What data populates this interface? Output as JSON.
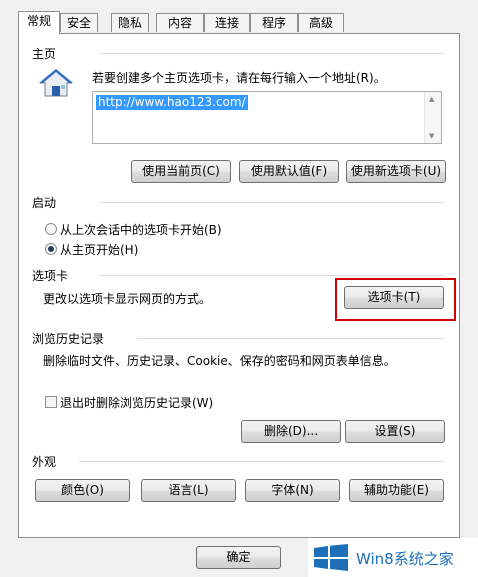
{
  "tabs": [
    {
      "label": "常规",
      "active": true
    },
    {
      "label": "安全",
      "active": false
    },
    {
      "label": "隐私",
      "active": false
    },
    {
      "label": "内容",
      "active": false
    },
    {
      "label": "连接",
      "active": false
    },
    {
      "label": "程序",
      "active": false
    },
    {
      "label": "高级",
      "active": false
    }
  ],
  "homepage": {
    "group_title": "主页",
    "description": "若要创建多个主页选项卡，请在每行输入一个地址(R)。",
    "url_value": "http://www.hao123.com/",
    "buttons": {
      "use_current": "使用当前页(C)",
      "use_default": "使用默认值(F)",
      "use_new_tab": "使用新选项卡(U)"
    }
  },
  "startup": {
    "group_title": "启动",
    "options": [
      {
        "label": "从上次会话中的选项卡开始(B)",
        "selected": false
      },
      {
        "label": "从主页开始(H)",
        "selected": true
      }
    ]
  },
  "tabs_section": {
    "group_title": "选项卡",
    "description": "更改以选项卡显示网页的方式。",
    "button": "选项卡(T)"
  },
  "history": {
    "group_title": "浏览历史记录",
    "description": "删除临时文件、历史记录、Cookie、保存的密码和网页表单信息。",
    "checkbox_label": "退出时删除浏览历史记录(W)",
    "checkbox_checked": false,
    "delete_button": "删除(D)...",
    "settings_button": "设置(S)"
  },
  "appearance": {
    "group_title": "外观",
    "buttons": {
      "colors": "颜色(O)",
      "languages": "语言(L)",
      "fonts": "字体(N)",
      "accessibility": "辅助功能(E)"
    }
  },
  "footer": {
    "ok_button": "确定"
  },
  "watermark": {
    "text": "Win8系统之家"
  },
  "colors": {
    "highlight_box": "#d40000",
    "selection": "#3399ff",
    "watermark_brand": "#1d6fb8"
  }
}
